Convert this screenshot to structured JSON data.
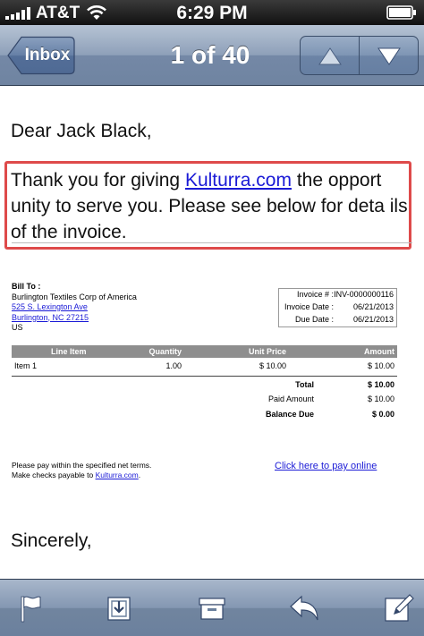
{
  "status_bar": {
    "carrier": "AT&T",
    "time": "6:29 PM",
    "signal_icon": "signal-bars-icon",
    "wifi_icon": "wifi-icon",
    "battery_icon": "battery-icon"
  },
  "nav": {
    "back_label": "Inbox",
    "title": "1 of 40",
    "prev_icon": "up-arrow-icon",
    "next_icon": "down-arrow-icon"
  },
  "email": {
    "greeting": "Dear Jack Black,",
    "intro_before": "Thank you for giving ",
    "intro_link": "Kulturra.com",
    "intro_after": " the opport unity to serve you. Please see below for deta ils of the invoice.",
    "highlight_color": "#de4a4a",
    "closing": "Sincerely,"
  },
  "invoice": {
    "bill_to_label": "Bill To :",
    "company": "Burlington Textiles Corp of America",
    "address_line1": "525 S. Lexington Ave",
    "address_line2": "Burlington, NC 27215",
    "country": "US",
    "number_label": "Invoice # :",
    "number": "INV-0000000116",
    "date_label": "Invoice Date :",
    "date": "06/21/2013",
    "due_label": "Due Date :",
    "due": "06/21/2013",
    "columns": [
      "Line Item",
      "Quantity",
      "Unit Price",
      "Amount"
    ],
    "items": [
      {
        "name": "Item 1",
        "quantity": "1.00",
        "unit_price": "$ 10.00",
        "amount": "$ 10.00"
      }
    ],
    "total_label": "Total",
    "total": "$ 10.00",
    "paid_label": "Paid Amount",
    "paid": "$ 10.00",
    "balance_label": "Balance Due",
    "balance": "$ 0.00",
    "note_line1": "Please pay within the specified net terms.",
    "note_line2_before": "Make checks payable to ",
    "note_line2_link": "Kulturra.com",
    "note_line2_after": ".",
    "pay_online": "Click here to pay online"
  },
  "toolbar": {
    "icons": [
      "flag-icon",
      "move-to-folder-icon",
      "archive-icon",
      "reply-icon",
      "compose-icon"
    ]
  },
  "colors": {
    "nav_blue": "#7e93b0",
    "link": "#1a1ad6"
  }
}
